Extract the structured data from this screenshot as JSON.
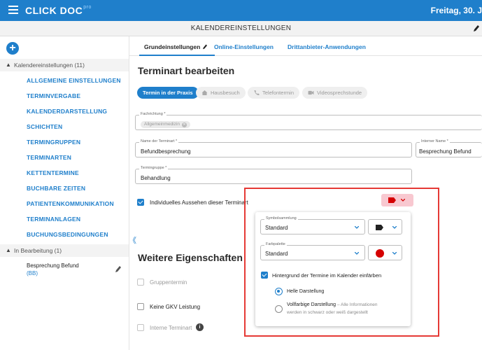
{
  "app": {
    "logo": "CLICK DOC",
    "logo_sup": "pro",
    "date": "Freitag, 30. J",
    "page_title": "KALENDEREINSTELLUNGEN"
  },
  "sidebar": {
    "add_label": "+",
    "group1_label": "Kalendereinstellungen (11)",
    "items": [
      "ALLGEMEINE EINSTELLUNGEN",
      "TERMINVERGABE",
      "KALENDERDARSTELLUNG",
      "SCHICHTEN",
      "TERMINGRUPPEN",
      "TERMINARTEN",
      "KETTENTERMINE",
      "BUCHBARE ZEITEN",
      "PATIENTENKOMMUNIKATION",
      "TERMINANLAGEN",
      "BUCHUNGSBEDINGUNGEN"
    ],
    "group2_label": "In Bearbeitung (1)",
    "editing_name": "Besprechung Befund",
    "editing_code": "(BB)",
    "collapse_glyph": "《"
  },
  "tabs": [
    "Grundeinstellungen",
    "Online-Einstellungen",
    "Drittanbieter-Anwendungen"
  ],
  "form": {
    "title": "Terminart bearbeiten",
    "types": [
      "Termin in der Praxis",
      "Hausbesuch",
      "Telefontermin",
      "Videosprechstunde"
    ],
    "specialty_label": "Fachrichtung *",
    "specialty_tag": "Allgemeinmedizin",
    "name_label": "Name der Terminart *",
    "name_value": "Befundbesprechung",
    "internal_label": "Interner Name *",
    "internal_value": "Besprechung Befund",
    "group_label": "Termingruppe *",
    "group_value": "Behandlung",
    "individual_look": "Individuelles Aussehen dieser Terminart",
    "individual_checked": true
  },
  "further": {
    "title": "Weitere Eigenschaften",
    "options": [
      {
        "label": "Gruppentermin",
        "checked": false,
        "dim": true
      },
      {
        "label": "Keine GKV Leistung",
        "checked": false,
        "dim": false
      },
      {
        "label": "Interne Terminart",
        "checked": false,
        "dim": true
      }
    ]
  },
  "panel": {
    "symbol_label": "Symbolsammlung",
    "symbol_value": "Standard",
    "palette_label": "Farbpalette",
    "palette_value": "Standard",
    "background_label": "Hintergrund der Termine im Kalender einfärben",
    "background_checked": true,
    "light_label": "Helle Darstellung",
    "full_label": "Vollfarbige Darstellung",
    "full_note_1": "– Alle Informationen",
    "full_note_2": "werden in schwarz oder weiß dargestellt",
    "selected_mode": "Helle Darstellung"
  },
  "colors": {
    "primary": "#1f7fcb",
    "accent_red": "#d50000",
    "highlight": "#e53935",
    "tag_bg": "#f8c8d0"
  }
}
